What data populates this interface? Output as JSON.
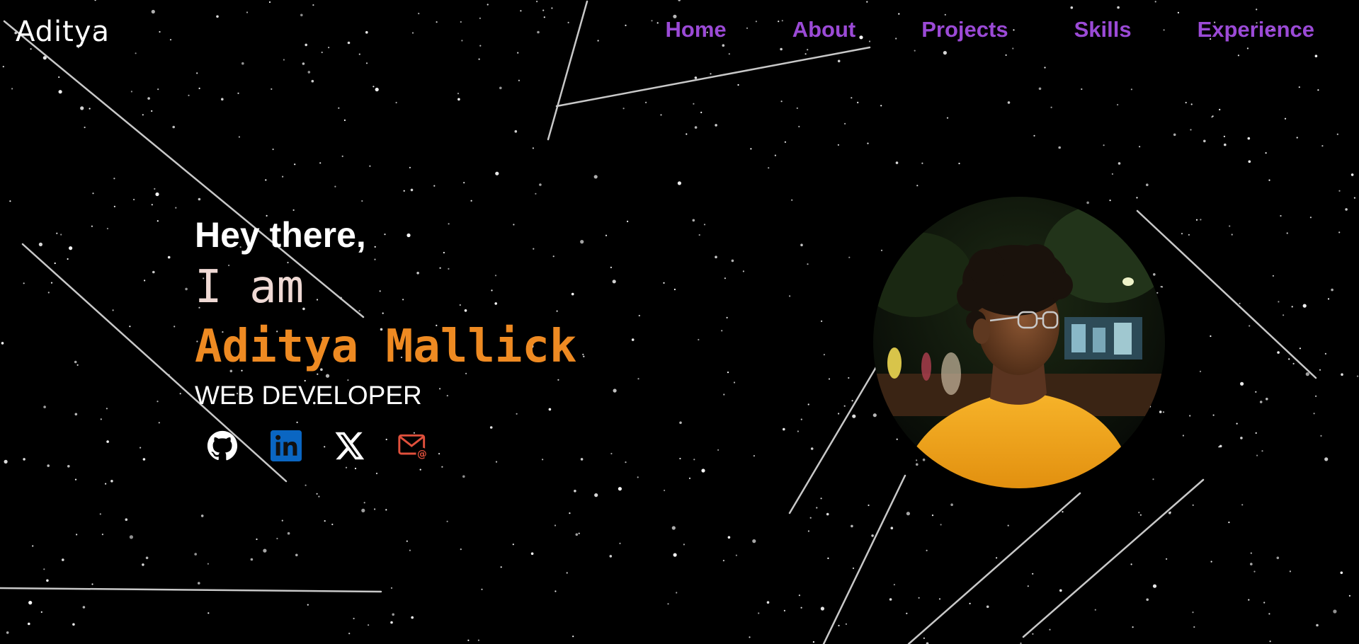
{
  "logo": {
    "text": "Aditya"
  },
  "nav": {
    "items": [
      {
        "label": "Home"
      },
      {
        "label": "About"
      },
      {
        "label": "Projects"
      },
      {
        "label": "Skills"
      },
      {
        "label": "Experience"
      }
    ],
    "color": "#9b4ad6"
  },
  "hero": {
    "greeting": "Hey there,",
    "intro": "I am",
    "name": "Aditya Mallick",
    "role": "WEB DEVELOPER"
  },
  "socials": [
    {
      "icon": "github-icon"
    },
    {
      "icon": "linkedin-icon"
    },
    {
      "icon": "x-twitter-icon"
    },
    {
      "icon": "email-icon"
    }
  ],
  "colors": {
    "background": "#000000",
    "name_accent": "#ee8a22",
    "intro_text": "#efd9d4",
    "linkedin_blue": "#0a66c2",
    "email_red": "#e0503c",
    "shirt": "#f5a51c"
  }
}
